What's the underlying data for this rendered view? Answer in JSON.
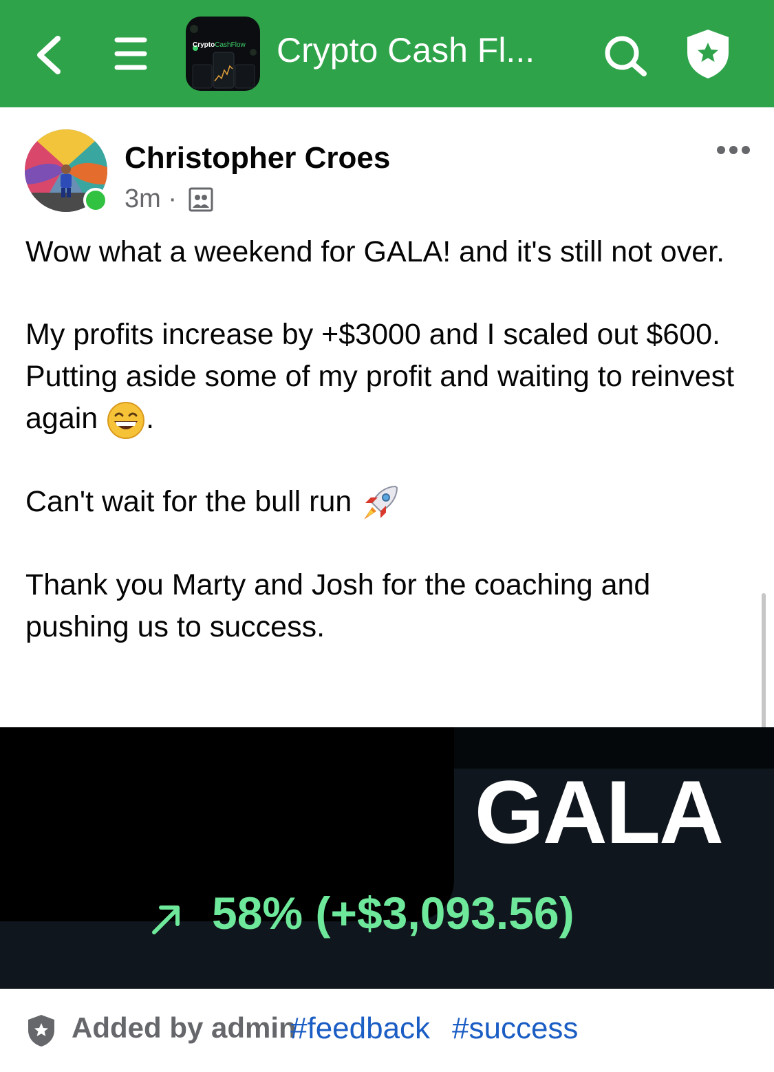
{
  "header": {
    "logo_text_main": "Crypto",
    "logo_text_accent": "CashFlow",
    "title": "Crypto Cash Fl...",
    "icons": {
      "back": "chevron-left-icon",
      "menu": "hamburger-menu-icon",
      "search": "search-icon",
      "admin": "shield-star-icon"
    }
  },
  "post": {
    "author": "Christopher Croes",
    "time": "3m",
    "separator": "·",
    "audience_icon": "group-audience-icon",
    "more_icon": "more-options-icon",
    "paragraphs": [
      "Wow what a weekend for GALA! and it's still not over.",
      "My profits increase by +$3000 and I scaled out $600. Putting aside some of my profit and waiting to reinvest again",
      "Can't wait for the bull run",
      "Thank you Marty and Josh for the coaching and pushing us to success."
    ],
    "para2_suffix": ".",
    "emojis": {
      "grin": "grinning-face-emoji",
      "rocket": "rocket-emoji"
    }
  },
  "image": {
    "coin": "GALA",
    "change": "58% (+$3,093.56)",
    "arrow_icon": "arrow-up-right-icon"
  },
  "footer": {
    "added_by": "Added by admin",
    "tags": [
      "#feedback",
      "#success"
    ]
  },
  "colors": {
    "header_bg": "#2fa34a",
    "online": "#31c241",
    "tag": "#1a5dc4",
    "gain": "#6ee89a"
  }
}
